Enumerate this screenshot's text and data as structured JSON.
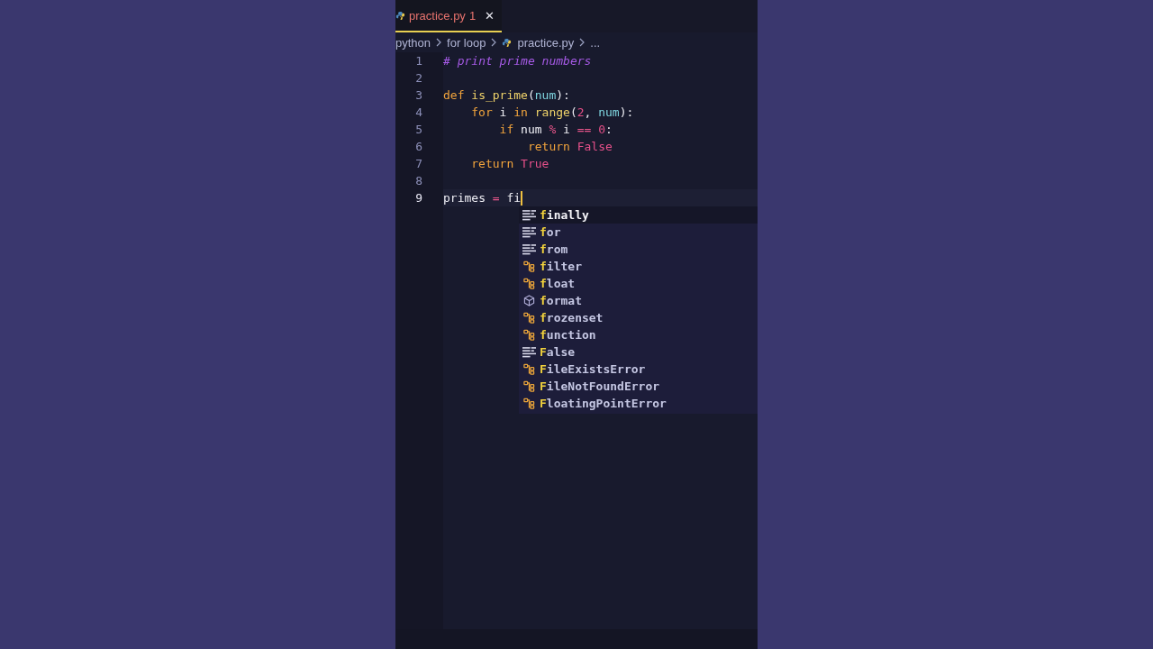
{
  "tabs": [
    {
      "label": "practice.py",
      "badge": "1",
      "close": "✕",
      "selected": true
    }
  ],
  "breadcrumb": [
    "python",
    "for loop",
    "practice.py",
    "..."
  ],
  "editor": {
    "lines": [
      {
        "number": "1",
        "current": false,
        "tokens": [
          {
            "kind": "comment",
            "text": "# print prime numbers"
          }
        ]
      },
      {
        "number": "2",
        "current": false
      },
      {
        "number": "3",
        "current": false,
        "tokens": [
          {
            "kind": "keyword",
            "text": "def"
          },
          {
            "kind": "function",
            "text": " is_prime"
          },
          {
            "kind": "plain",
            "text": "("
          },
          {
            "kind": "param",
            "text": "num"
          },
          {
            "kind": "plain",
            "text": "):"
          }
        ],
        "children": [
          {
            "number": "4",
            "current": false,
            "tokens": [
              {
                "kind": "keyword",
                "text": "for"
              },
              {
                "kind": "plain",
                "text": " i "
              },
              {
                "kind": "keyword",
                "text": "in"
              },
              {
                "kind": "function",
                "text": " range"
              },
              {
                "kind": "plain",
                "text": "("
              },
              {
                "kind": "number",
                "text": "2"
              },
              {
                "kind": "plain",
                "text": ", "
              },
              {
                "kind": "param",
                "text": "num"
              },
              {
                "kind": "plain",
                "text": "):"
              }
            ],
            "children": [
              {
                "number": "5",
                "current": false,
                "tokens": [
                  {
                    "kind": "keyword",
                    "text": "if"
                  },
                  {
                    "kind": "plain",
                    "text": " num "
                  },
                  {
                    "kind": "operator",
                    "text": "%"
                  },
                  {
                    "kind": "plain",
                    "text": " i "
                  },
                  {
                    "kind": "operator",
                    "text": "=="
                  },
                  {
                    "kind": "number",
                    "text": " 0"
                  },
                  {
                    "kind": "plain",
                    "text": ":"
                  }
                ],
                "children": [
                  {
                    "number": "6",
                    "current": false,
                    "tokens": [
                      {
                        "kind": "keyword",
                        "text": "return"
                      },
                      {
                        "kind": "constant",
                        "text": " False"
                      }
                    ]
                  }
                ]
              }
            ]
          },
          {
            "number": "7",
            "current": false,
            "tokens": [
              {
                "kind": "keyword",
                "text": "return"
              },
              {
                "kind": "constant",
                "text": " True"
              }
            ]
          }
        ]
      },
      {
        "number": "8",
        "current": false
      },
      {
        "number": "9",
        "current": true,
        "tokens": [
          {
            "kind": "plain",
            "text": "primes "
          },
          {
            "kind": "operator",
            "text": "="
          },
          {
            "kind": "plain",
            "text": " fi"
          }
        ]
      }
    ]
  },
  "suggestions": [
    {
      "kind": "keyword",
      "highlight": "f",
      "rest": "inally",
      "selected": true
    },
    {
      "kind": "keyword",
      "highlight": "f",
      "rest": "or",
      "selected": false
    },
    {
      "kind": "keyword",
      "highlight": "f",
      "rest": "rom",
      "selected": false
    },
    {
      "kind": "class",
      "highlight": "f",
      "rest": "ilter",
      "selected": false
    },
    {
      "kind": "class",
      "highlight": "f",
      "rest": "loat",
      "selected": false
    },
    {
      "kind": "module",
      "highlight": "f",
      "rest": "ormat",
      "selected": false
    },
    {
      "kind": "class",
      "highlight": "f",
      "rest": "rozenset",
      "selected": false
    },
    {
      "kind": "class",
      "highlight": "f",
      "rest": "unction",
      "selected": false
    },
    {
      "kind": "keyword",
      "highlight": "F",
      "rest": "alse",
      "selected": false
    },
    {
      "kind": "class",
      "highlight": "F",
      "rest": "ileExistsError",
      "selected": false
    },
    {
      "kind": "class",
      "highlight": "F",
      "rest": "ileNotFoundError",
      "selected": false
    },
    {
      "kind": "class",
      "highlight": "F",
      "rest": "loatingPointError",
      "selected": false
    }
  ]
}
